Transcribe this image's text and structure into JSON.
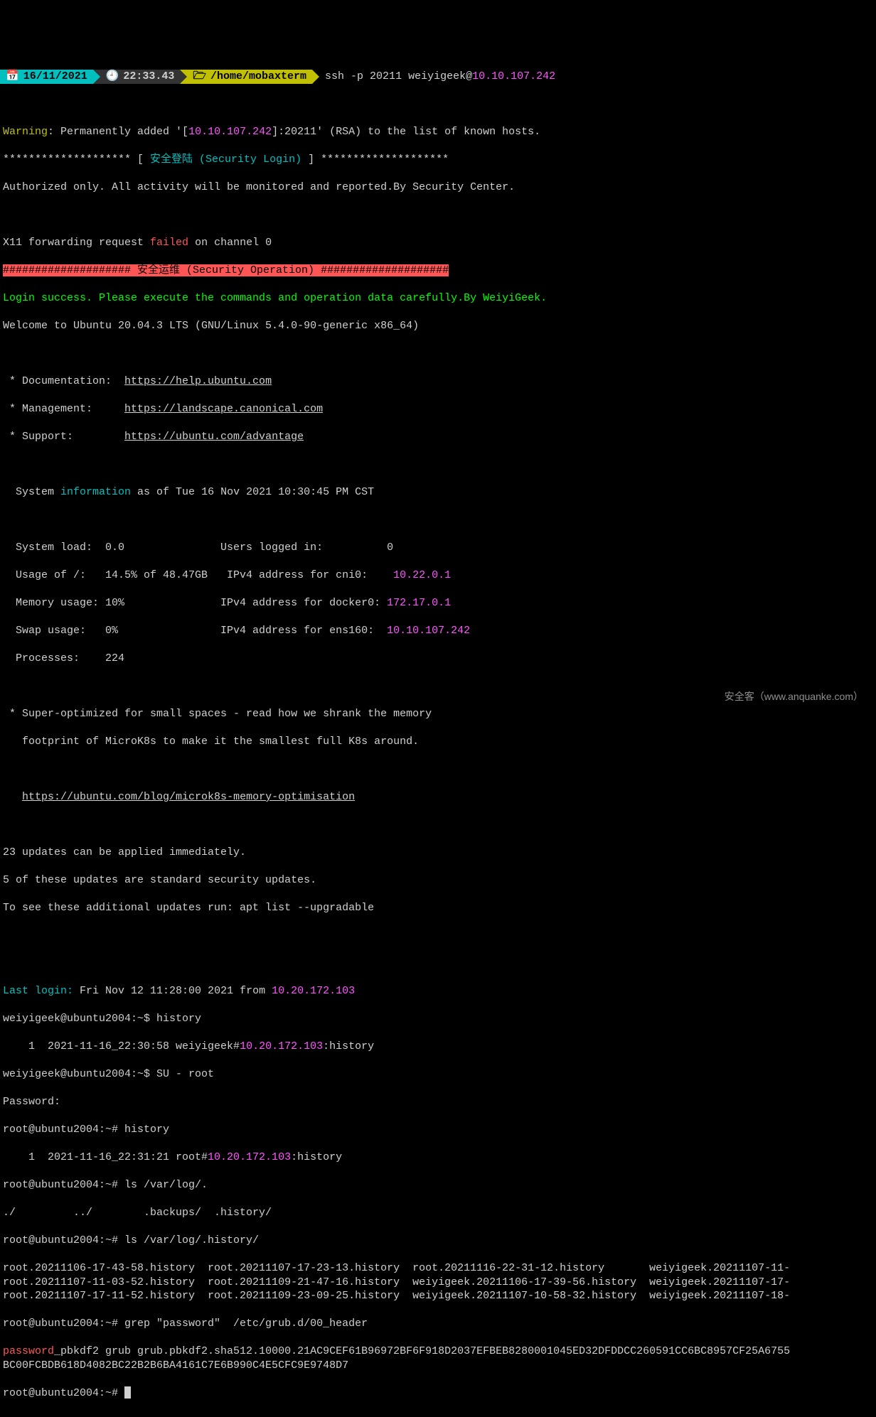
{
  "header": {
    "date": "16/11/2021",
    "time": "22:33.43",
    "path": "/home/mobaxterm",
    "cmd_prefix": "ssh -p 20211 weiyigeek@",
    "cmd_host": "10.10.107.242",
    "date_icon": "📅",
    "time_icon": "🕘",
    "path_icon": "🗁"
  },
  "warn": {
    "label": "Warning",
    "p1": ": Permanently added '[",
    "ip": "10.10.107.242",
    "p2": "]:20211' (RSA) to the list of known hosts."
  },
  "banner": {
    "l1a": "******************** [ ",
    "l1b": "安全登陆 (Security Login)",
    "l1c": " ] ********************",
    "l2": "Authorized only. All activity will be monitored and reported.By Security Center."
  },
  "x11": {
    "p1": "X11 forwarding request ",
    "failed": "failed",
    "p2": " on channel 0"
  },
  "secop": "#################### 安全运维 (Security Operation) ####################",
  "login_success": "Login success. Please execute the commands and operation data carefully.By WeiyiGeek.",
  "welcome": "Welcome to Ubuntu 20.04.3 LTS (GNU/Linux 5.4.0-90-generic x86_64)",
  "docs": {
    "d1": " * Documentation:  ",
    "u1": "https://help.ubuntu.com",
    "d2": " * Management:     ",
    "u2": "https://landscape.canonical.com",
    "d3": " * Support:        ",
    "u3": "https://ubuntu.com/advantage"
  },
  "sysinfo": {
    "prefix": "  System ",
    "word": "information",
    "suffix": " as of Tue 16 Nov 2021 10:30:45 PM CST"
  },
  "stats": {
    "r1": {
      "left": "  System load:  0.0               Users logged in:          0"
    },
    "r2": {
      "left": "  Usage of /:   14.5% of 48.47GB   IPv4 address for cni0:    ",
      "ip": "10.22.0.1"
    },
    "r3": {
      "left": "  Memory usage: 10%               IPv4 address for docker0: ",
      "ip": "172.17.0.1"
    },
    "r4": {
      "left": "  Swap usage:   0%                IPv4 address for ens160:  ",
      "ip": "10.10.107.242"
    },
    "r5": {
      "left": "  Processes:    224"
    }
  },
  "promo": {
    "l1": " * Super-optimized for small spaces - read how we shrank the memory",
    "l2": "   footprint of MicroK8s to make it the smallest full K8s around.",
    "url": "https://ubuntu.com/blog/microk8s-memory-optimisation",
    "url_pad": "   "
  },
  "updates": {
    "l1": "23 updates can be applied immediately.",
    "l2": "5 of these updates are standard security updates.",
    "l3": "To see these additional updates run: apt list --upgradable"
  },
  "lastlogin": {
    "label": "Last login:",
    "mid": " Fri Nov 12 11:28:00 2021 from ",
    "ip": "10.20.172.103"
  },
  "shell": {
    "p1": "weiyigeek@ubuntu2004:~$ history",
    "h1a": "    1  2021-11-16_22:30:58 weiyigeek#",
    "h1ip": "10.20.172.103",
    "h1b": ":history",
    "p2": "weiyigeek@ubuntu2004:~$ SU - root",
    "pw": "Password:",
    "p3": "root@ubuntu2004:~# history",
    "h2a": "    1  2021-11-16_22:31:21 root#",
    "h2ip": "10.20.172.103",
    "h2b": ":history",
    "p4": "root@ubuntu2004:~# ls /var/log/.",
    "ls1": "./         ../        .backups/  .history/",
    "p5": "root@ubuntu2004:~# ls /var/log/.history/",
    "files": "root.20211106-17-43-58.history  root.20211107-17-23-13.history  root.20211116-22-31-12.history       weiyigeek.20211107-11-\nroot.20211107-11-03-52.history  root.20211109-21-47-16.history  weiyigeek.20211106-17-39-56.history  weiyigeek.20211107-17-\nroot.20211107-17-11-52.history  root.20211109-23-09-25.history  weiyigeek.20211107-10-58-32.history  weiyigeek.20211107-18-",
    "p6": "root@ubuntu2004:~# grep \"password\"  /etc/grub.d/00_header",
    "pwword": "password",
    "pwrest": "_pbkdf2 grub grub.pbkdf2.sha512.10000.21AC9CEF61B96972BF6F918D2037EFBEB8280001045ED32DFDDCC260591CC6BC8957CF25A6755\nBC00FCBDB618D4082BC22B2B6BA4161C7E6B990C4E5CFC9E9748D7",
    "p7": "root@ubuntu2004:~# "
  },
  "watermark": "安全客（www.anquanke.com）"
}
